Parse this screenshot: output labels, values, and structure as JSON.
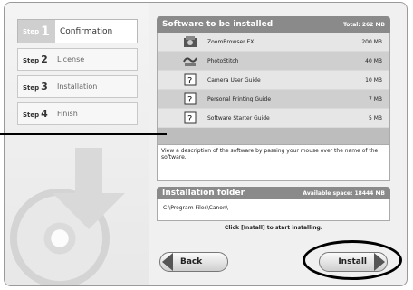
{
  "steps": [
    {
      "prefix": "Step",
      "num": "1",
      "label": "Confirmation",
      "active": true
    },
    {
      "prefix": "Step",
      "num": "2",
      "label": "License",
      "active": false
    },
    {
      "prefix": "Step",
      "num": "3",
      "label": "Installation",
      "active": false
    },
    {
      "prefix": "Step",
      "num": "4",
      "label": "Finish",
      "active": false
    }
  ],
  "software": {
    "title": "Software to be installed",
    "total": "Total: 262 MB",
    "items": [
      {
        "icon": "zoombrowser-icon",
        "name": "ZoomBrowser EX",
        "size": "200 MB"
      },
      {
        "icon": "photostitch-icon",
        "name": "PhotoStitch",
        "size": "40 MB"
      },
      {
        "icon": "guide-book-icon",
        "name": "Camera User Guide",
        "size": "10 MB"
      },
      {
        "icon": "guide-book-icon",
        "name": "Personal Printing Guide",
        "size": "7 MB"
      },
      {
        "icon": "guide-book-icon",
        "name": "Software Starter Guide",
        "size": "5 MB"
      }
    ],
    "description": "View a description of the software by passing your mouse over the name of the software."
  },
  "folder": {
    "title": "Installation folder",
    "available": "Available space: 18444 MB",
    "path": "C:\\Program Files\\Canon\\"
  },
  "instruction": "Click [Install] to start installing.",
  "buttons": {
    "back": "Back",
    "install": "Install"
  }
}
